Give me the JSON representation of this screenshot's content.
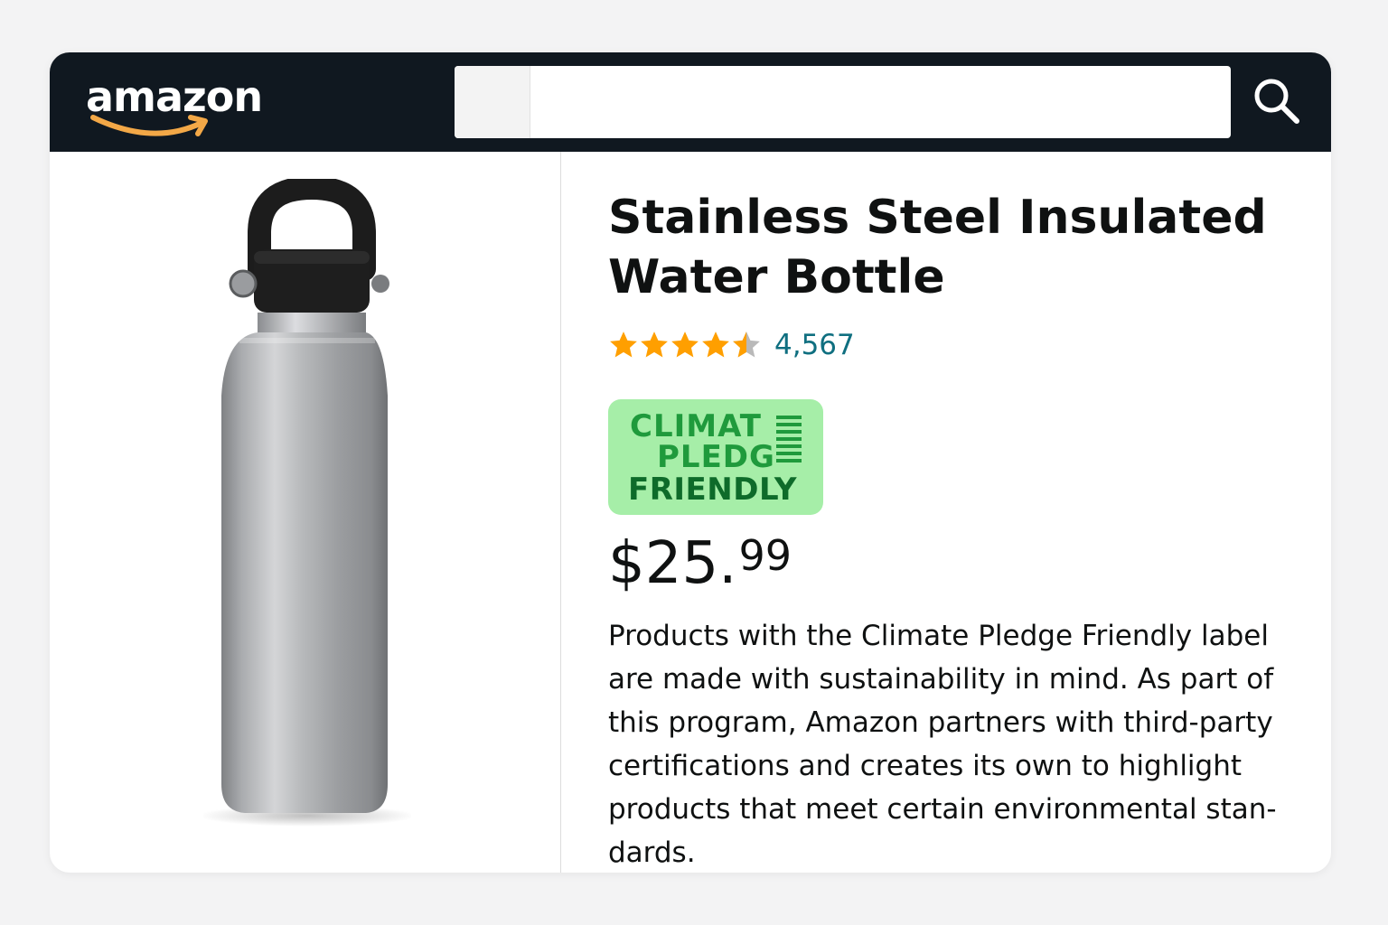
{
  "header": {
    "logo_text": "amazon",
    "search": {
      "value": "",
      "placeholder": ""
    },
    "colors": {
      "bar": "#101820",
      "logo_smile": "#f3a847"
    }
  },
  "product": {
    "image_icon": "insulated-water-bottle",
    "title": "Stainless Steel Insulated Water Bottle",
    "rating": {
      "value": 4.5,
      "max": 5,
      "review_count": "4,567"
    },
    "badge": {
      "line1": "CLIMAT",
      "line2": "PLEDG",
      "line3": "FRIENDLY"
    },
    "price": {
      "main": "$25.",
      "fraction": "99"
    },
    "description": "Products with the Climate Pledge Friendly label are made with sustainability in mind. As part of this program, Amazon partners with third-party certifications and creates its own to highlight products that meet certain environmental stan-dards."
  },
  "colors": {
    "star": "#ff9f00",
    "review_link": "#0f6f80",
    "badge_bg": "#a6eea8",
    "badge_text": "#1f9a3c"
  }
}
